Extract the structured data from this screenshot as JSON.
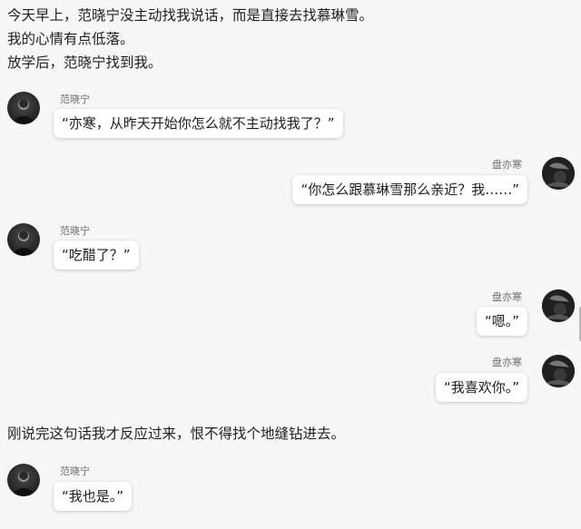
{
  "narration": {
    "line1": "今天早上，范晓宁没主动找我说话，而是直接去找慕琳雪。",
    "line2": "我的心情有点低落。",
    "line3": "放学后，范晓宁找到我。",
    "line4": "刚说完这句话我才反应过来，恨不得找个地缝钻进去。"
  },
  "messages": [
    {
      "sender": "范晓宁",
      "side": "left",
      "text": "“亦寒，从昨天开始你怎么就不主动找我了？”"
    },
    {
      "sender": "盘亦寒",
      "side": "right",
      "text": "“你怎么跟慕琳雪那么亲近？我……”"
    },
    {
      "sender": "范晓宁",
      "side": "left",
      "text": "“吃醋了？”"
    },
    {
      "sender": "盘亦寒",
      "side": "right",
      "text": "“嗯。”"
    },
    {
      "sender": "盘亦寒",
      "side": "right",
      "text": "“我喜欢你。”"
    },
    {
      "sender": "范晓宁",
      "side": "left",
      "text": "“我也是。”"
    }
  ]
}
